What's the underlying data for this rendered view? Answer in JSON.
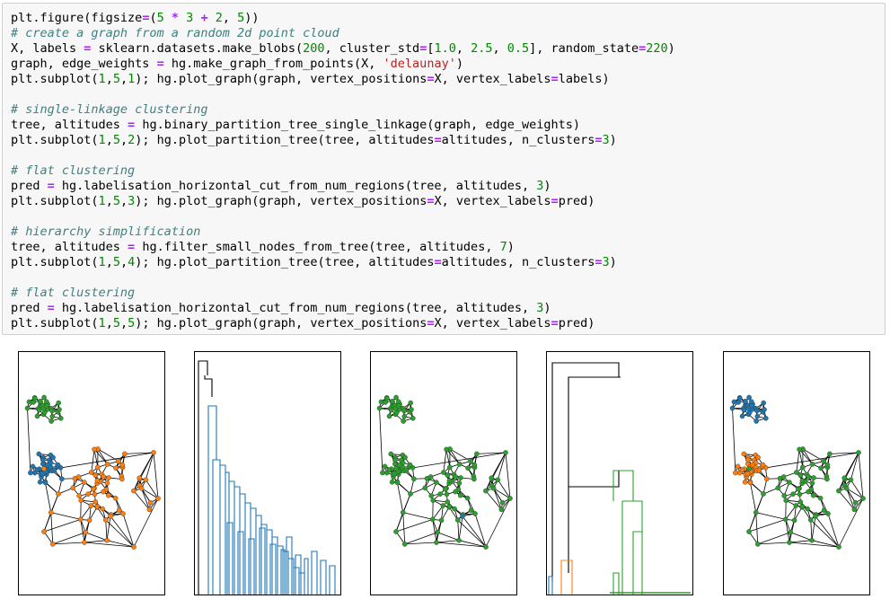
{
  "code_lines": [
    "plt.figure(figsize=(5 * 3 + 2, 5))",
    "# create a graph from a random 2d point cloud",
    "X, labels = sklearn.datasets.make_blobs(200, cluster_std=[1.0, 2.5, 0.5], random_state=220)",
    "graph, edge_weights = hg.make_graph_from_points(X, 'delaunay')",
    "plt.subplot(1,5,1); hg.plot_graph(graph, vertex_positions=X, vertex_labels=labels)",
    "",
    "# single-linkage clustering",
    "tree, altitudes = hg.binary_partition_tree_single_linkage(graph, edge_weights)",
    "plt.subplot(1,5,2); hg.plot_partition_tree(tree, altitudes=altitudes, n_clusters=3)",
    "",
    "# flat clustering",
    "pred = hg.labelisation_horizontal_cut_from_num_regions(tree, altitudes, 3)",
    "plt.subplot(1,5,3); hg.plot_graph(graph, vertex_positions=X, vertex_labels=pred)",
    "",
    "# hierarchy simplification",
    "tree, altitudes = hg.filter_small_nodes_from_tree(tree, altitudes, 7)",
    "plt.subplot(1,5,4); hg.plot_partition_tree(tree, altitudes=altitudes, n_clusters=3)",
    "",
    "# flat clustering",
    "pred = hg.labelisation_horizontal_cut_from_num_regions(tree, altitudes, 3)",
    "plt.subplot(1,5,5); hg.plot_graph(graph, vertex_positions=X, vertex_labels=pred)"
  ],
  "colors": {
    "blue": "#1f77b4",
    "orange": "#ff7f0e",
    "green": "#2ca02c",
    "edge": "#000000",
    "keyword": "#aa22ff",
    "number": "#008800",
    "string": "#ba2121",
    "comment": "#408080",
    "cell_bg": "#f7f7f7"
  },
  "figures": [
    {
      "type": "graph",
      "labeling": "ground-truth labels"
    },
    {
      "type": "dendrogram",
      "clusters": 3
    },
    {
      "type": "graph",
      "labeling": "pred (single-linkage cut)"
    },
    {
      "type": "dendrogram",
      "clusters": 3,
      "filtered": true
    },
    {
      "type": "graph",
      "labeling": "pred (simplified cut)"
    }
  ]
}
